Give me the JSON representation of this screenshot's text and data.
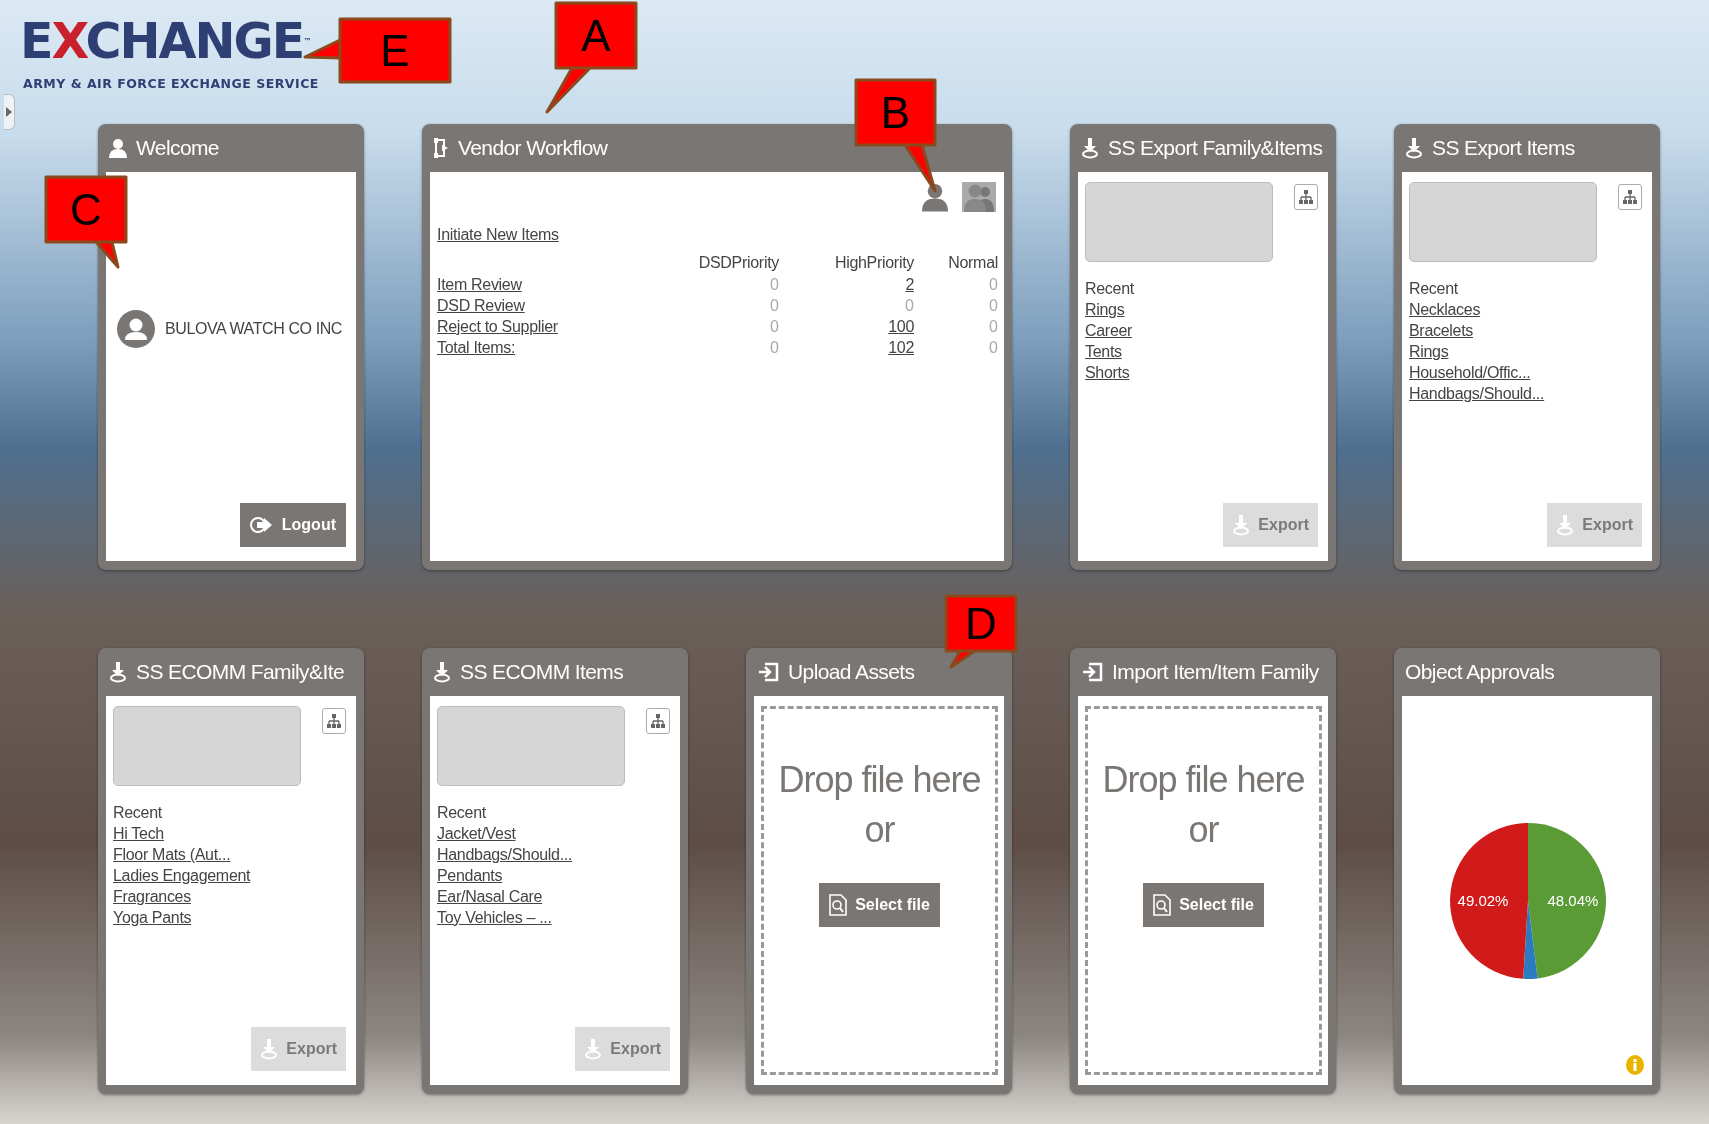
{
  "logo": {
    "wordmark": "EXCHANGE",
    "trademark": "™",
    "tagline": "ARMY & AIR FORCE EXCHANGE SERVICE"
  },
  "tiles": [
    {
      "kind": "welcome",
      "title": "Welcome",
      "user": "BULOVA WATCH CO INC",
      "button": "Logout"
    },
    {
      "kind": "workflow",
      "title": "Vendor Workflow",
      "initiate": "Initiate New Items",
      "columns": [
        "DSDPriority",
        "HighPriority",
        "Normal"
      ],
      "rows": [
        {
          "label": "Item Review",
          "cells": [
            {
              "value": "0",
              "link": false
            },
            {
              "value": "2",
              "link": true
            },
            {
              "value": "0",
              "link": false
            }
          ]
        },
        {
          "label": "DSD Review",
          "cells": [
            {
              "value": "0",
              "link": false
            },
            {
              "value": "0",
              "link": false
            },
            {
              "value": "0",
              "link": false
            }
          ]
        },
        {
          "label": "Reject to Supplier",
          "cells": [
            {
              "value": "0",
              "link": false
            },
            {
              "value": "100",
              "link": true
            },
            {
              "value": "0",
              "link": false
            }
          ]
        },
        {
          "label": "Total Items:",
          "cells": [
            {
              "value": "0",
              "link": false
            },
            {
              "value": "102",
              "link": true
            },
            {
              "value": "0",
              "link": false
            }
          ]
        }
      ]
    },
    {
      "kind": "export",
      "title": "SS Export Family&Items",
      "recent_label": "Recent",
      "recent": [
        "Rings",
        "Career",
        "Tents",
        "Shorts"
      ],
      "button": {
        "label": "Export",
        "disabled": true
      }
    },
    {
      "kind": "export",
      "title": "SS Export Items",
      "recent_label": "Recent",
      "recent": [
        "Necklaces",
        "Bracelets",
        "Rings",
        "Household/Offic...",
        "Handbags/Should..."
      ],
      "button": {
        "label": "Export",
        "disabled": true
      }
    },
    {
      "kind": "export",
      "title": "SS ECOMM Family&Ite",
      "recent_label": "Recent",
      "recent": [
        "Hi Tech",
        "Floor Mats (Aut...",
        "Ladies Engagement",
        "Fragrances",
        "Yoga Pants"
      ],
      "button": {
        "label": "Export",
        "disabled": true
      }
    },
    {
      "kind": "export",
      "title": "SS ECOMM Items",
      "recent_label": "Recent",
      "recent": [
        "Jacket/Vest",
        "Handbags/Should...",
        "Pendants",
        "Ear/Nasal Care",
        "Toy Vehicles – ..."
      ],
      "button": {
        "label": "Export",
        "disabled": true
      }
    },
    {
      "kind": "upload",
      "title": "Upload Assets",
      "drop_text": "Drop file here",
      "or_text": "or",
      "button": "Select file"
    },
    {
      "kind": "upload",
      "title": "Import Item/Item Family",
      "drop_text": "Drop file here",
      "or_text": "or",
      "button": "Select file"
    },
    {
      "kind": "chart",
      "title": "Object Approvals",
      "chart_data": {
        "type": "pie",
        "values": [
          48.04,
          2.94,
          49.02
        ],
        "value_labels": [
          "48.04%",
          null,
          "49.02%"
        ]
      }
    }
  ],
  "callouts": [
    {
      "label": "A"
    },
    {
      "label": "B"
    },
    {
      "label": "C"
    },
    {
      "label": "D"
    },
    {
      "label": "E"
    }
  ]
}
